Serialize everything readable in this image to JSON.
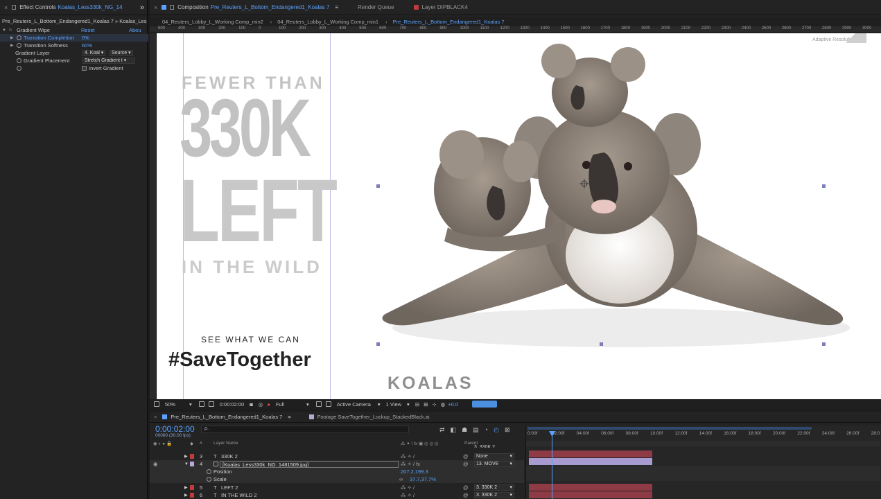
{
  "effect_controls": {
    "tab_close": "×",
    "tab_title": "Effect Controls",
    "tab_layer": "Koalas_Less330k_NG_14",
    "expand": "»",
    "subtitle": "Pre_Reuters_L_Bottom_Endangered1_Koalas 7 » Koalas_Les",
    "effect_name": "Gradient Wipe",
    "reset_label": "Reset",
    "about_label": "Abou",
    "props": [
      {
        "name": "Transition Completion",
        "value": "0%"
      },
      {
        "name": "Transition Softness",
        "value": "60%"
      },
      {
        "name": "Gradient Layer",
        "value": "4. Koal",
        "extra": "Source"
      },
      {
        "name": "Gradient Placement",
        "value": "Stretch Gradient t"
      },
      {
        "name": "",
        "value": "Invert Gradient"
      }
    ]
  },
  "comp_tabs": {
    "close": "×",
    "composition_prefix": "Composition",
    "composition_name": "Pre_Reuters_L_Bottom_Endangered1_Koalas 7",
    "menu": "≡",
    "render_queue": "Render Queue",
    "layer_tab": "Layer DIPBLACK4"
  },
  "breadcrumbs": [
    "04_Reuters_Lobby_L_Working Comp_min2",
    "04_Reuters_Lobby_L_Working Comp_min1",
    "Pre_Reuters_L_Bottom_Endangered1_Koalas 7"
  ],
  "ruler_h": [
    "500",
    "400",
    "300",
    "200",
    "100",
    "0",
    "100",
    "200",
    "300",
    "400",
    "500",
    "600",
    "700",
    "800",
    "900",
    "1000",
    "1100",
    "1200",
    "1300",
    "1400",
    "1500",
    "1600",
    "1700",
    "1800",
    "1900",
    "2000",
    "2100",
    "2200",
    "2300",
    "2400",
    "2500",
    "2600",
    "2700",
    "2800",
    "2900",
    "3000"
  ],
  "adaptive_resolution": "Adaptive Resolution (1/2)",
  "poster": {
    "line1": "FEWER THAN",
    "line2": "330K",
    "line3": "LEFT",
    "line4": "IN THE WILD",
    "tagline": "SEE WHAT WE CAN",
    "hashtag": "#SaveTogether",
    "brand": "KOALAS"
  },
  "viewer_bar": {
    "zoom": "50%",
    "time": "0:00:02:00",
    "resolution": "Full",
    "camera": "Active Camera",
    "views": "1 View",
    "exposure": "+0.0"
  },
  "timeline_tabs": {
    "close": "×",
    "comp_name": "Pre_Reuters_L_Bottom_Endangered1_Koalas 7",
    "menu": "≡",
    "footage": "Footage SaveTogether_Lockup_StackedBlack.ai"
  },
  "timecode": "0:00:02:00",
  "frame_info": "00060 (30.00 fps)",
  "search_placeholder": "ρ.",
  "columns": {
    "hash": "#",
    "layer_name": "Layer Name",
    "parent": "Parent"
  },
  "time_ruler": [
    "0:00f",
    "02:00f",
    "04:00f",
    "06:00f",
    "08:00f",
    "10:00f",
    "12:00f",
    "14:00f",
    "16:00f",
    "18:00f",
    "20:00f",
    "22:00f",
    "24:00f",
    "26:00f",
    "28:0"
  ],
  "layers": [
    {
      "num": "3",
      "type": "T",
      "name": "330K 2",
      "parent": "None",
      "color": "#c23a3a"
    },
    {
      "num": "4",
      "type": "img",
      "name": "[Koalas_Less330k_NG_1481509.jpg]",
      "parent": "13. MOVE",
      "color": "#b7a8d6"
    },
    {
      "num": "5",
      "type": "T",
      "name": "LEFT 2",
      "parent": "3. 330K 2",
      "color": "#c23a3a"
    },
    {
      "num": "6",
      "type": "T",
      "name": "IN THE WILD 2",
      "parent": "3. 330K 2",
      "color": "#c23a3a"
    }
  ],
  "sub_props": [
    {
      "name": "Position",
      "value": "207.2,199.3"
    },
    {
      "name": "Scale",
      "value": "37.7,37.7%"
    }
  ],
  "partial_parent": "3. 330K 2",
  "colors": {
    "accent": "#5aa2ff",
    "label_red": "#c23a3a",
    "label_purple": "#b7a8d6",
    "bar_red": "#8e3b45",
    "bar_purple": "#a89bcf"
  }
}
